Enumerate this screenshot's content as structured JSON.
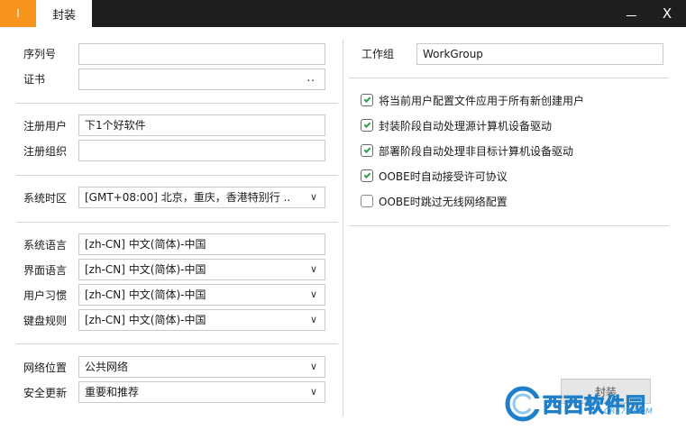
{
  "window": {
    "app_tab_label": "I",
    "active_tab_label": "封装",
    "minimize_label": "",
    "close_label": "X"
  },
  "left": {
    "serial_label": "序列号",
    "serial_value": "",
    "cert_label": "证书",
    "cert_value": "",
    "cert_browse": "..",
    "reg_user_label": "注册用户",
    "reg_user_value": "下1个好软件",
    "reg_org_label": "注册组织",
    "reg_org_value": "",
    "timezone_label": "系统时区",
    "timezone_value": "[GMT+08:00] 北京，重庆，香港特别行 ..",
    "sys_lang_label": "系统语言",
    "sys_lang_value": "[zh-CN] 中文(简体)-中国",
    "ui_lang_label": "界面语言",
    "ui_lang_value": "[zh-CN] 中文(简体)-中国",
    "user_locale_label": "用户习惯",
    "user_locale_value": "[zh-CN] 中文(简体)-中国",
    "keyboard_label": "键盘规则",
    "keyboard_value": "[zh-CN] 中文(简体)-中国",
    "network_label": "网络位置",
    "network_value": "公共网络",
    "update_label": "安全更新",
    "update_value": "重要和推荐"
  },
  "right": {
    "workgroup_label": "工作组",
    "workgroup_value": "WorkGroup",
    "options": [
      {
        "label": "将当前用户配置文件应用于所有新创建用户",
        "checked": true
      },
      {
        "label": "封装阶段自动处理源计算机设备驱动",
        "checked": true
      },
      {
        "label": "部署阶段自动处理非目标计算机设备驱动",
        "checked": true
      },
      {
        "label": "OOBE时自动接受许可协议",
        "checked": true
      },
      {
        "label": "OOBE时跳过无线网络配置",
        "checked": false
      }
    ],
    "seal_button": "封装"
  },
  "watermark": {
    "brand": "西西软件园",
    "url": "CR173.COM"
  },
  "icons": {
    "dropdown": "chevron-down-icon",
    "check": "checkmark-icon",
    "close": "close-icon",
    "minimize": "minimize-icon"
  },
  "colors": {
    "titlebar": "#1e1e1e",
    "accent_orange": "#f7941d",
    "check_green": "#2f9e44",
    "watermark_blue": "#1f7fc8"
  }
}
